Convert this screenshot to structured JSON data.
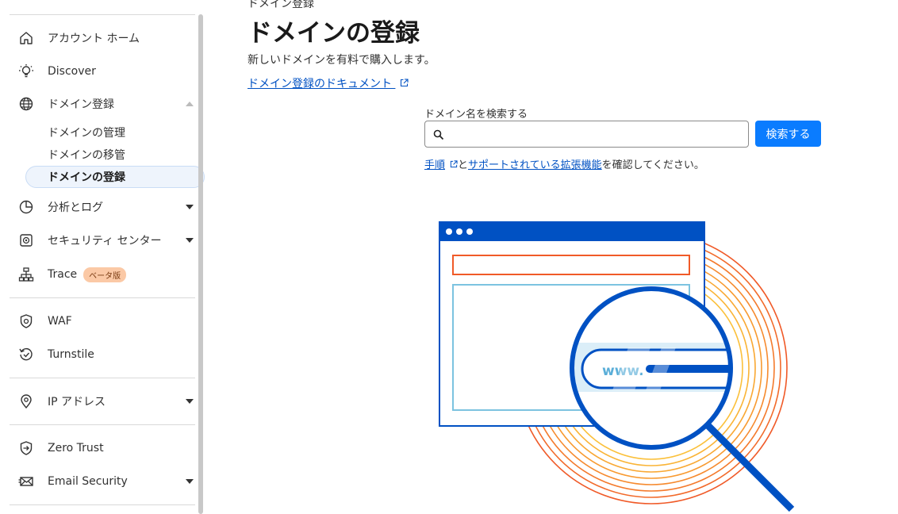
{
  "sidebar": {
    "items": [
      {
        "label": "アカウント ホーム",
        "icon": "home-icon"
      },
      {
        "label": "Discover",
        "icon": "lightbulb-icon"
      },
      {
        "label": "ドメイン登録",
        "icon": "globe-icon",
        "expanded": true,
        "children": [
          {
            "label": "ドメインの管理"
          },
          {
            "label": "ドメインの移管"
          },
          {
            "label": "ドメインの登録",
            "active": true
          }
        ]
      },
      {
        "label": "分析とログ",
        "icon": "pie-chart-icon"
      },
      {
        "label": "セキュリティ センター",
        "icon": "security-center-icon"
      },
      {
        "label": "Trace",
        "icon": "trace-icon",
        "badge": "ベータ版"
      },
      {
        "label": "WAF",
        "icon": "waf-shield-icon"
      },
      {
        "label": "Turnstile",
        "icon": "turnstile-icon"
      },
      {
        "label": "IP アドレス",
        "icon": "location-pin-icon"
      },
      {
        "label": "Zero Trust",
        "icon": "zero-trust-icon"
      },
      {
        "label": "Email Security",
        "icon": "email-icon"
      }
    ]
  },
  "main": {
    "breadcrumb": "ドメイン登録",
    "title": "ドメインの登録",
    "description": "新しいドメインを有料で購入します。",
    "doc_link": "ドメイン登録のドキュメント",
    "search": {
      "label": "ドメイン名を検索する",
      "value": "",
      "placeholder": "",
      "button": "検索する"
    },
    "hint": {
      "link1": "手順",
      "mid": "と",
      "link2": "サポートされている拡張機能",
      "tail": "を確認してください。"
    },
    "illustration": {
      "text": "www."
    }
  },
  "colors": {
    "accent": "#0a7cff",
    "link": "#0051c3",
    "illustration_blue": "#0051c3",
    "illustration_orange": "#f6821f"
  }
}
